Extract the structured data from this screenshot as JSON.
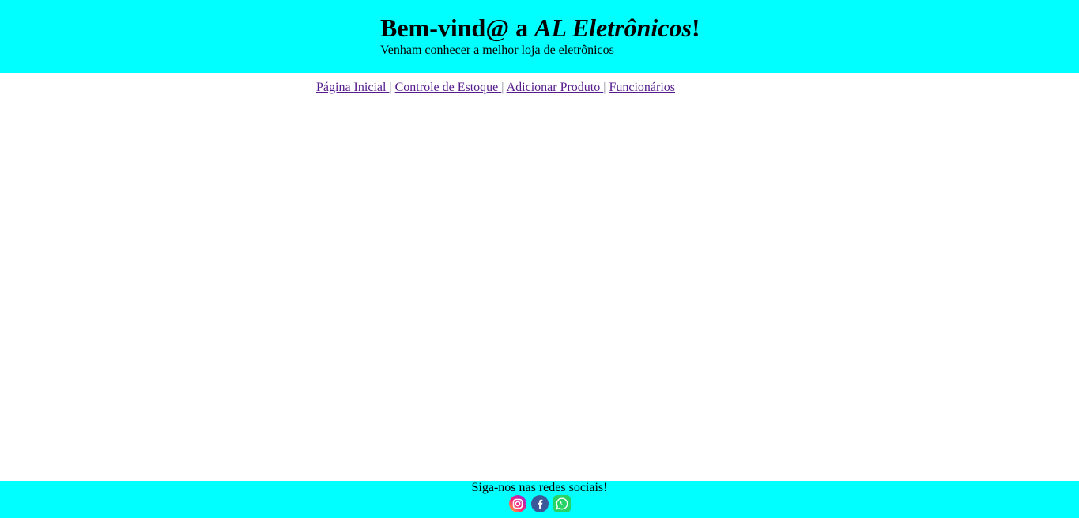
{
  "header": {
    "title_prefix": "Bem-vind@ a ",
    "brand": "AL Eletrônicos",
    "title_suffix": "!",
    "subtitle": "Venham conhecer a melhor loja de eletrônicos",
    "background_color": "#00ffff"
  },
  "nav": {
    "items": [
      {
        "label": "Página Inicial "
      },
      {
        "label": "Controle de Estoque "
      },
      {
        "label": "Adicionar Produto "
      },
      {
        "label": "Funcionários"
      }
    ],
    "separator": "|",
    "link_color": "#551a8b"
  },
  "footer": {
    "text": "Siga-nos nas redes sociais!",
    "social_icons": [
      "instagram-icon",
      "facebook-icon",
      "whatsapp-icon"
    ],
    "background_color": "#00ffff"
  }
}
